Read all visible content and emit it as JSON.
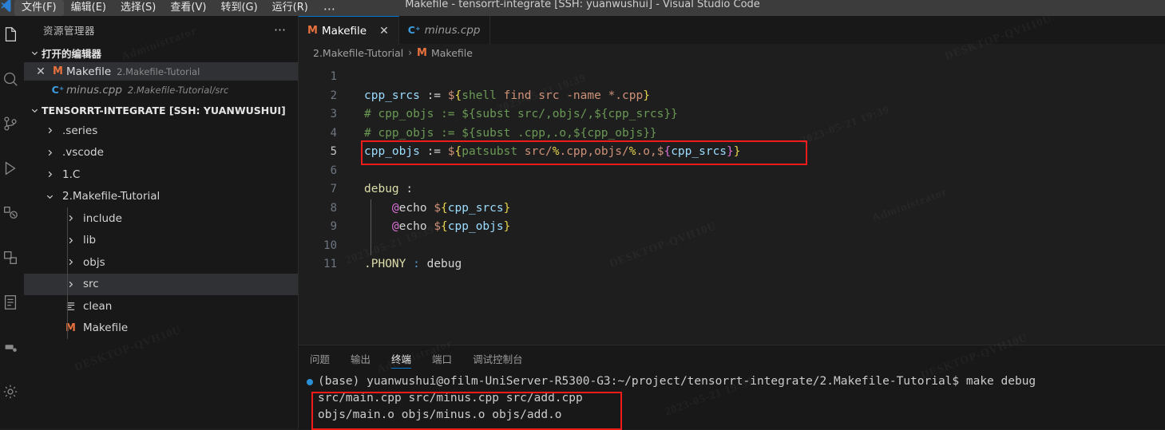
{
  "titlebar": {
    "title": "Makefile - tensorrt-integrate [SSH: yuanwushui] - Visual Studio Code",
    "menu": [
      {
        "label": "文件(F)",
        "active": true
      },
      {
        "label": "编辑(E)",
        "active": false
      },
      {
        "label": "选择(S)",
        "active": false
      },
      {
        "label": "查看(V)",
        "active": false
      },
      {
        "label": "转到(G)",
        "active": false
      },
      {
        "label": "运行(R)",
        "active": false
      }
    ],
    "more_label": "⋯"
  },
  "activitybar": {
    "icons": [
      {
        "name": "explorer-icon",
        "selected": true
      },
      {
        "name": "search-icon",
        "selected": false
      },
      {
        "name": "source-control-icon",
        "selected": false
      },
      {
        "name": "run-debug-icon",
        "selected": false
      },
      {
        "name": "extensions-icon",
        "selected": false
      },
      {
        "name": "remote-explorer-icon",
        "selected": false
      },
      {
        "name": "testing-icon",
        "selected": false
      },
      {
        "name": "docker-icon",
        "selected": false
      },
      {
        "name": "settings-gear-icon",
        "selected": false
      }
    ]
  },
  "sidebar": {
    "title": "资源管理器",
    "more_label": "⋯",
    "open_editors": {
      "label": "打开的编辑器",
      "items": [
        {
          "close_label": "✕",
          "icon": "makefile-icon",
          "icon_glyph": "M",
          "name": "Makefile",
          "path": "2.Makefile-Tutorial",
          "selected": true,
          "italic": false
        },
        {
          "close_label": "",
          "icon": "cpp-file-icon",
          "icon_glyph": "C⁺",
          "name": "minus.cpp",
          "path": "2.Makefile-Tutorial/src",
          "selected": false,
          "italic": true
        }
      ]
    },
    "workspace": {
      "label": "TENSORRT-INTEGRATE [SSH: YUANWUSHUI]",
      "tree": [
        {
          "label": ".series",
          "type": "folder",
          "expanded": false,
          "depth": 1,
          "selected": false
        },
        {
          "label": ".vscode",
          "type": "folder",
          "expanded": false,
          "depth": 1,
          "selected": false
        },
        {
          "label": "1.C",
          "type": "folder",
          "expanded": false,
          "depth": 1,
          "selected": false
        },
        {
          "label": "2.Makefile-Tutorial",
          "type": "folder",
          "expanded": true,
          "depth": 1,
          "selected": false
        },
        {
          "label": "include",
          "type": "folder",
          "expanded": false,
          "depth": 2,
          "selected": false
        },
        {
          "label": "lib",
          "type": "folder",
          "expanded": false,
          "depth": 2,
          "selected": false
        },
        {
          "label": "objs",
          "type": "folder",
          "expanded": false,
          "depth": 2,
          "selected": false
        },
        {
          "label": "src",
          "type": "folder",
          "expanded": false,
          "depth": 2,
          "selected": true
        },
        {
          "label": "clean",
          "type": "file-text",
          "expanded": false,
          "depth": 2,
          "selected": false
        },
        {
          "label": "Makefile",
          "type": "file-makefile",
          "expanded": false,
          "depth": 2,
          "selected": false
        }
      ]
    }
  },
  "editor": {
    "tabs": [
      {
        "name": "Makefile",
        "icon": "makefile-icon",
        "icon_glyph": "M",
        "active": true,
        "italic": false,
        "close_label": "✕"
      },
      {
        "name": "minus.cpp",
        "icon": "cpp-file-icon",
        "icon_glyph": "C⁺",
        "active": false,
        "italic": true,
        "close_label": ""
      }
    ],
    "breadcrumb": {
      "folder": "2.Makefile-Tutorial",
      "separator": "›",
      "file_icon_glyph": "M",
      "file": "Makefile"
    },
    "current_line": 5,
    "lines": [
      {
        "num": 1,
        "tokens": []
      },
      {
        "num": 2,
        "tokens": [
          {
            "text": "cpp_srcs",
            "cls": "t-var"
          },
          {
            "text": " := ",
            "cls": "t-op"
          },
          {
            "text": "$",
            "cls": "t-dollar"
          },
          {
            "text": "{",
            "cls": "t-brace"
          },
          {
            "text": "shell",
            "cls": "t-func"
          },
          {
            "text": " find src -name *.cpp",
            "cls": "t-str"
          },
          {
            "text": "}",
            "cls": "t-brace"
          }
        ]
      },
      {
        "num": 3,
        "tokens": [
          {
            "text": "# cpp_objs := ${subst src/,objs/,${cpp_srcs}}",
            "cls": "t-cmt"
          }
        ]
      },
      {
        "num": 4,
        "tokens": [
          {
            "text": "# cpp_objs := ${subst .cpp,.o,${cpp_objs}}",
            "cls": "t-cmt"
          }
        ]
      },
      {
        "num": 5,
        "tokens": [
          {
            "text": "cpp_objs",
            "cls": "t-var"
          },
          {
            "text": " := ",
            "cls": "t-op"
          },
          {
            "text": "$",
            "cls": "t-dollar"
          },
          {
            "text": "{",
            "cls": "t-brace"
          },
          {
            "text": "patsubst",
            "cls": "t-func"
          },
          {
            "text": " src/",
            "cls": "t-str"
          },
          {
            "text": "%",
            "cls": "t-brace"
          },
          {
            "text": ".cpp,objs/",
            "cls": "t-str"
          },
          {
            "text": "%",
            "cls": "t-brace"
          },
          {
            "text": ".o,",
            "cls": "t-str"
          },
          {
            "text": "$",
            "cls": "t-dollar"
          },
          {
            "text": "{",
            "cls": "t-brace2"
          },
          {
            "text": "cpp_srcs",
            "cls": "t-var"
          },
          {
            "text": "}",
            "cls": "t-brace2"
          },
          {
            "text": "}",
            "cls": "t-brace"
          }
        ]
      },
      {
        "num": 6,
        "tokens": []
      },
      {
        "num": 7,
        "tokens": [
          {
            "text": "debug",
            "cls": "t-tgt"
          },
          {
            "text": " :",
            "cls": "t-plain"
          }
        ]
      },
      {
        "num": 8,
        "indent": true,
        "tokens": [
          {
            "text": "    ",
            "cls": "t-plain"
          },
          {
            "text": "@",
            "cls": "t-at"
          },
          {
            "text": "echo",
            "cls": "t-plain"
          },
          {
            "text": " ",
            "cls": "t-plain"
          },
          {
            "text": "$",
            "cls": "t-dollar"
          },
          {
            "text": "{",
            "cls": "t-brace"
          },
          {
            "text": "cpp_srcs",
            "cls": "t-var"
          },
          {
            "text": "}",
            "cls": "t-brace"
          }
        ]
      },
      {
        "num": 9,
        "indent": true,
        "tokens": [
          {
            "text": "    ",
            "cls": "t-plain"
          },
          {
            "text": "@",
            "cls": "t-at"
          },
          {
            "text": "echo",
            "cls": "t-plain"
          },
          {
            "text": " ",
            "cls": "t-plain"
          },
          {
            "text": "$",
            "cls": "t-dollar"
          },
          {
            "text": "{",
            "cls": "t-brace"
          },
          {
            "text": "cpp_objs",
            "cls": "t-var"
          },
          {
            "text": "}",
            "cls": "t-brace"
          }
        ]
      },
      {
        "num": 10,
        "indent": true,
        "tokens": []
      },
      {
        "num": 11,
        "tokens": [
          {
            "text": ".PHONY",
            "cls": "t-tgt"
          },
          {
            "text": " ",
            "cls": "t-plain"
          },
          {
            "text": ":",
            "cls": "t-colon"
          },
          {
            "text": " debug",
            "cls": "t-plain"
          }
        ]
      }
    ],
    "highlight_color": "#f01c1c"
  },
  "panel": {
    "tabs": [
      {
        "label": "问题",
        "active": false
      },
      {
        "label": "输出",
        "active": false
      },
      {
        "label": "终端",
        "active": true
      },
      {
        "label": "端口",
        "active": false
      },
      {
        "label": "调试控制台",
        "active": false
      }
    ],
    "terminal": {
      "prompt_line": "(base) yuanwushui@ofilm-UniServer-R5300-G3:~/project/tensorrt-integrate/2.Makefile-Tutorial$ make debug",
      "output_lines": [
        "src/main.cpp src/minus.cpp src/add.cpp",
        "objs/main.o objs/minus.o objs/add.o"
      ]
    }
  },
  "watermarks": [
    "Administrator",
    "DESKTOP-QVH10U",
    "2023-05-21 19:39"
  ]
}
